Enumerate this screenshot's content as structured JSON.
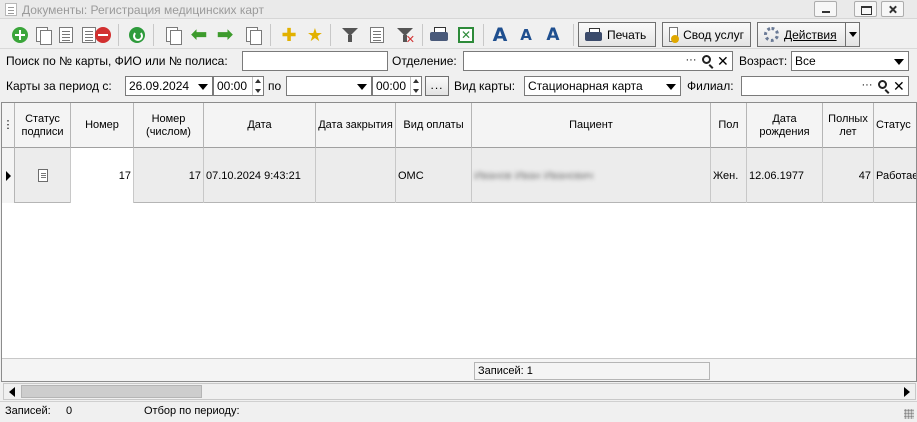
{
  "window": {
    "title": "Документы: Регистрация медицинских карт"
  },
  "toolbar": {
    "print_label": "Печать",
    "svod_label": "Свод услуг",
    "actions_label": "Действия"
  },
  "filters": {
    "search_label": "Поиск по № карты, ФИО или № полиса:",
    "search_value": "",
    "department_label": "Отделение:",
    "department_value": "",
    "age_label": "Возраст:",
    "age_value": "Все",
    "period_label": "Карты за период с:",
    "date_from": "26.09.2024",
    "time_from": "00:00",
    "to_label": "по",
    "date_to": "",
    "time_to": "00:00",
    "dots_label": "...",
    "card_type_label": "Вид карты:",
    "card_type_value": "Стационарная карта",
    "branch_label": "Филиал:",
    "branch_value": ""
  },
  "table": {
    "columns": [
      "Статус подписи",
      "Номер",
      "Номер (числом)",
      "Дата",
      "Дата закрытия",
      "Вид оплаты",
      "Пациент",
      "Пол",
      "Дата рождения",
      "Полных лет",
      "Статус"
    ],
    "rows": [
      {
        "status_icon": "document-icon",
        "number": "17",
        "number_numeric": "17",
        "date": "07.10.2024 9:43:21",
        "close_date": "",
        "payment": "ОМС",
        "patient": "Иванов Иван Иванович",
        "sex": "Жен.",
        "birth_date": "12.06.1977",
        "age": "47",
        "status": "Работает"
      }
    ],
    "footer_records": "Записей: 1"
  },
  "statusbar": {
    "records_label": "Записей:",
    "records_value": "0",
    "period_filter_label": "Отбор по периоду:"
  }
}
